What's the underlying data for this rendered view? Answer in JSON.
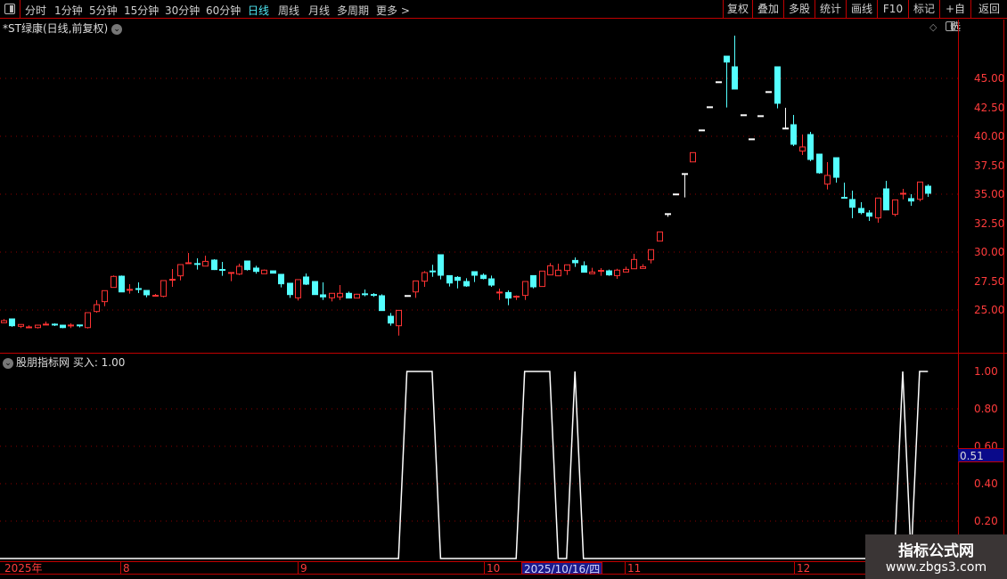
{
  "toolbar": {
    "periods": [
      "分时",
      "1分钟",
      "5分钟",
      "15分钟",
      "30分钟",
      "60分钟",
      "日线",
      "周线",
      "月线",
      "多周期",
      "更多 >"
    ],
    "active_period": "日线",
    "buttons": [
      "复权",
      "叠加",
      "多股",
      "统计",
      "画线",
      "F10",
      "标记",
      "+自选",
      "返回"
    ]
  },
  "stock_title": "*ST绿康(日线,前复权)",
  "indicator_title": "股朋指标网  买入: 1.00",
  "price_axis": {
    "labels": [
      "45.00",
      "42.50",
      "40.00",
      "37.50",
      "35.00",
      "32.50",
      "30.00",
      "27.50",
      "25.00"
    ],
    "min": 25,
    "max": 45
  },
  "indicator_axis": {
    "labels": [
      "1.00",
      "0.80",
      "0.60",
      "0.40",
      "0.20"
    ],
    "current_value": "0.51"
  },
  "date_axis": {
    "labels": [
      "2025年",
      "8",
      "9",
      "10",
      "11",
      "12"
    ],
    "selected_date": "2025/10/16/四"
  },
  "watermark": {
    "line1": "指标公式网",
    "line2": "www.zbgs3.com"
  },
  "colors": {
    "up": "#ff3333",
    "down": "#54ffff",
    "flat": "#ffffff",
    "grid": "#8b0000",
    "axis": "#c00000",
    "indicator": "#ffffff"
  },
  "chart_data": {
    "type": "candlestick",
    "candles_ohlc": [
      [
        23.9,
        24.21,
        23.9,
        24.08
      ],
      [
        24.23,
        24.25,
        23.55,
        23.64
      ],
      [
        23.59,
        23.75,
        23.44,
        23.75
      ],
      [
        23.45,
        23.67,
        23.42,
        23.5
      ],
      [
        23.48,
        23.72,
        23.4,
        23.69
      ],
      [
        23.7,
        24.0,
        23.7,
        23.74
      ],
      [
        23.74,
        23.85,
        23.62,
        23.7
      ],
      [
        23.69,
        23.72,
        23.42,
        23.48
      ],
      [
        23.62,
        23.85,
        23.44,
        23.66
      ],
      [
        23.67,
        23.72,
        23.5,
        23.56
      ],
      [
        23.48,
        24.77,
        23.4,
        24.77
      ],
      [
        24.87,
        25.85,
        24.77,
        25.46
      ],
      [
        25.72,
        26.67,
        25.33,
        26.67
      ],
      [
        26.95,
        27.98,
        26.95,
        27.9
      ],
      [
        27.92,
        27.98,
        26.56,
        26.56
      ],
      [
        26.7,
        27.23,
        26.41,
        26.74
      ],
      [
        26.81,
        27.38,
        26.46,
        26.77
      ],
      [
        26.69,
        26.69,
        26.1,
        26.31
      ],
      [
        26.18,
        26.38,
        26.18,
        26.23
      ],
      [
        26.18,
        27.54,
        26.1,
        27.54
      ],
      [
        27.57,
        28.54,
        27.0,
        27.61
      ],
      [
        27.95,
        28.92,
        27.56,
        28.92
      ],
      [
        28.98,
        29.92,
        28.98,
        29.04
      ],
      [
        28.97,
        29.46,
        28.49,
        28.93
      ],
      [
        28.79,
        29.69,
        28.79,
        29.2
      ],
      [
        29.31,
        29.38,
        28.45,
        28.49
      ],
      [
        28.46,
        29.15,
        27.95,
        28.42
      ],
      [
        28.16,
        28.2,
        27.49,
        28.2
      ],
      [
        28.1,
        29.0,
        28.02,
        28.77
      ],
      [
        29.23,
        29.25,
        28.4,
        28.49
      ],
      [
        28.62,
        28.82,
        28.13,
        28.33
      ],
      [
        28.13,
        28.5,
        28.13,
        28.44
      ],
      [
        28.38,
        28.38,
        28.18,
        28.18
      ],
      [
        28.08,
        28.08,
        26.95,
        27.26
      ],
      [
        27.31,
        27.31,
        26.05,
        26.33
      ],
      [
        26.05,
        27.62,
        25.82,
        27.62
      ],
      [
        27.85,
        28.15,
        27.15,
        27.23
      ],
      [
        27.46,
        27.5,
        26.33,
        26.33
      ],
      [
        26.31,
        27.38,
        25.87,
        26.13
      ],
      [
        26.05,
        26.44,
        25.74,
        26.44
      ],
      [
        26.13,
        27.15,
        25.87,
        26.44
      ],
      [
        26.44,
        26.59,
        26.03,
        26.03
      ],
      [
        26.03,
        26.4,
        26.0,
        26.36
      ],
      [
        26.36,
        26.77,
        26.18,
        26.31
      ],
      [
        26.3,
        26.46,
        26.13,
        26.26
      ],
      [
        26.23,
        26.36,
        24.95,
        24.95
      ],
      [
        24.46,
        24.74,
        23.64,
        23.87
      ],
      [
        23.64,
        24.97,
        22.79,
        24.97
      ],
      [
        26.21,
        26.21,
        26.21,
        26.21
      ],
      [
        26.56,
        27.51,
        26.05,
        27.51
      ],
      [
        27.49,
        28.36,
        27.0,
        28.23
      ],
      [
        28.33,
        28.9,
        27.87,
        28.29
      ],
      [
        29.77,
        29.77,
        27.64,
        28.0
      ],
      [
        27.97,
        27.97,
        27.03,
        27.33
      ],
      [
        27.82,
        27.92,
        26.87,
        27.56
      ],
      [
        27.46,
        27.74,
        27.0,
        27.08
      ],
      [
        28.31,
        28.31,
        27.41,
        28.0
      ],
      [
        28.0,
        28.15,
        27.64,
        27.72
      ],
      [
        27.69,
        27.97,
        27.0,
        27.15
      ],
      [
        26.47,
        26.85,
        25.87,
        26.51
      ],
      [
        26.51,
        26.69,
        25.41,
        26.03
      ],
      [
        26.11,
        26.26,
        25.87,
        26.15
      ],
      [
        26.26,
        27.46,
        25.87,
        27.46
      ],
      [
        27.97,
        27.97,
        26.87,
        27.0
      ],
      [
        27.03,
        28.36,
        27.03,
        28.36
      ],
      [
        28.03,
        29.05,
        28.03,
        28.82
      ],
      [
        27.95,
        29.0,
        27.95,
        28.44
      ],
      [
        28.41,
        28.9,
        28.03,
        28.9
      ],
      [
        29.28,
        29.54,
        28.72,
        29.08
      ],
      [
        28.82,
        29.2,
        28.26,
        28.26
      ],
      [
        28.13,
        28.64,
        28.13,
        28.28
      ],
      [
        28.34,
        28.62,
        27.95,
        28.38
      ],
      [
        28.38,
        28.49,
        27.95,
        28.03
      ],
      [
        27.97,
        28.56,
        27.69,
        28.44
      ],
      [
        28.28,
        28.74,
        28.28,
        28.51
      ],
      [
        28.56,
        29.85,
        28.56,
        29.36
      ],
      [
        28.59,
        28.95,
        28.59,
        28.74
      ],
      [
        29.33,
        30.21,
        29.02,
        30.21
      ],
      [
        30.95,
        31.74,
        30.95,
        31.74
      ],
      [
        33.28,
        33.28,
        33.05,
        33.28
      ],
      [
        34.98,
        34.98,
        34.98,
        34.98
      ],
      [
        36.74,
        36.74,
        34.72,
        36.74
      ],
      [
        37.79,
        38.59,
        37.79,
        38.59
      ],
      [
        40.51,
        40.51,
        40.51,
        40.51
      ],
      [
        42.51,
        42.51,
        42.51,
        42.51
      ],
      [
        44.67,
        44.67,
        44.67,
        44.67
      ],
      [
        46.92,
        46.92,
        42.49,
        46.41
      ],
      [
        46.0,
        48.69,
        44.08,
        44.08
      ],
      [
        41.82,
        41.82,
        41.82,
        41.82
      ],
      [
        39.74,
        39.74,
        39.74,
        39.74
      ],
      [
        41.74,
        41.74,
        41.74,
        41.74
      ],
      [
        43.82,
        43.82,
        43.82,
        43.82
      ],
      [
        46.0,
        46.0,
        42.41,
        42.85
      ],
      [
        40.67,
        42.46,
        40.67,
        40.67
      ],
      [
        41.0,
        41.85,
        39.15,
        39.31
      ],
      [
        38.72,
        40.15,
        38.38,
        39.08
      ],
      [
        40.15,
        40.38,
        37.85,
        38.0
      ],
      [
        38.46,
        38.5,
        36.77,
        36.85
      ],
      [
        35.87,
        37.77,
        35.41,
        36.62
      ],
      [
        38.15,
        38.15,
        36.0,
        36.46
      ],
      [
        34.69,
        36.0,
        34.65,
        34.67
      ],
      [
        34.54,
        35.31,
        32.92,
        33.87
      ],
      [
        33.77,
        34.31,
        33.26,
        33.41
      ],
      [
        33.38,
        33.62,
        32.69,
        33.1
      ],
      [
        32.95,
        34.67,
        32.54,
        34.67
      ],
      [
        35.46,
        36.15,
        33.64,
        33.64
      ],
      [
        33.26,
        34.51,
        33.1,
        34.51
      ],
      [
        35.0,
        35.46,
        34.56,
        35.04
      ],
      [
        34.62,
        35.0,
        34.0,
        34.41
      ],
      [
        34.56,
        36.05,
        34.38,
        36.05
      ],
      [
        35.69,
        35.85,
        34.77,
        35.08
      ]
    ],
    "indicator": {
      "name": "买入",
      "range": [
        0,
        1
      ],
      "values": [
        0,
        0,
        0,
        0,
        0,
        0,
        0,
        0,
        0,
        0,
        0,
        0,
        0,
        0,
        0,
        0,
        0,
        0,
        0,
        0,
        0,
        0,
        0,
        0,
        0,
        0,
        0,
        0,
        0,
        0,
        0,
        0,
        0,
        0,
        0,
        0,
        0,
        0,
        0,
        0,
        0,
        0,
        0,
        0,
        0,
        0,
        0,
        0,
        1,
        1,
        1,
        1,
        0,
        0,
        0,
        0,
        0,
        0,
        0,
        0,
        0,
        0,
        1,
        1,
        1,
        1,
        0,
        0,
        1,
        0,
        0,
        0,
        0,
        0,
        0,
        0,
        0,
        0,
        0,
        0,
        0,
        0,
        0,
        0,
        0,
        0,
        0,
        0,
        0,
        0,
        0,
        0,
        0,
        0,
        0,
        0,
        0,
        0,
        0,
        0,
        0,
        0,
        0,
        0,
        0,
        0,
        0,
        1,
        0,
        1,
        1
      ]
    }
  }
}
